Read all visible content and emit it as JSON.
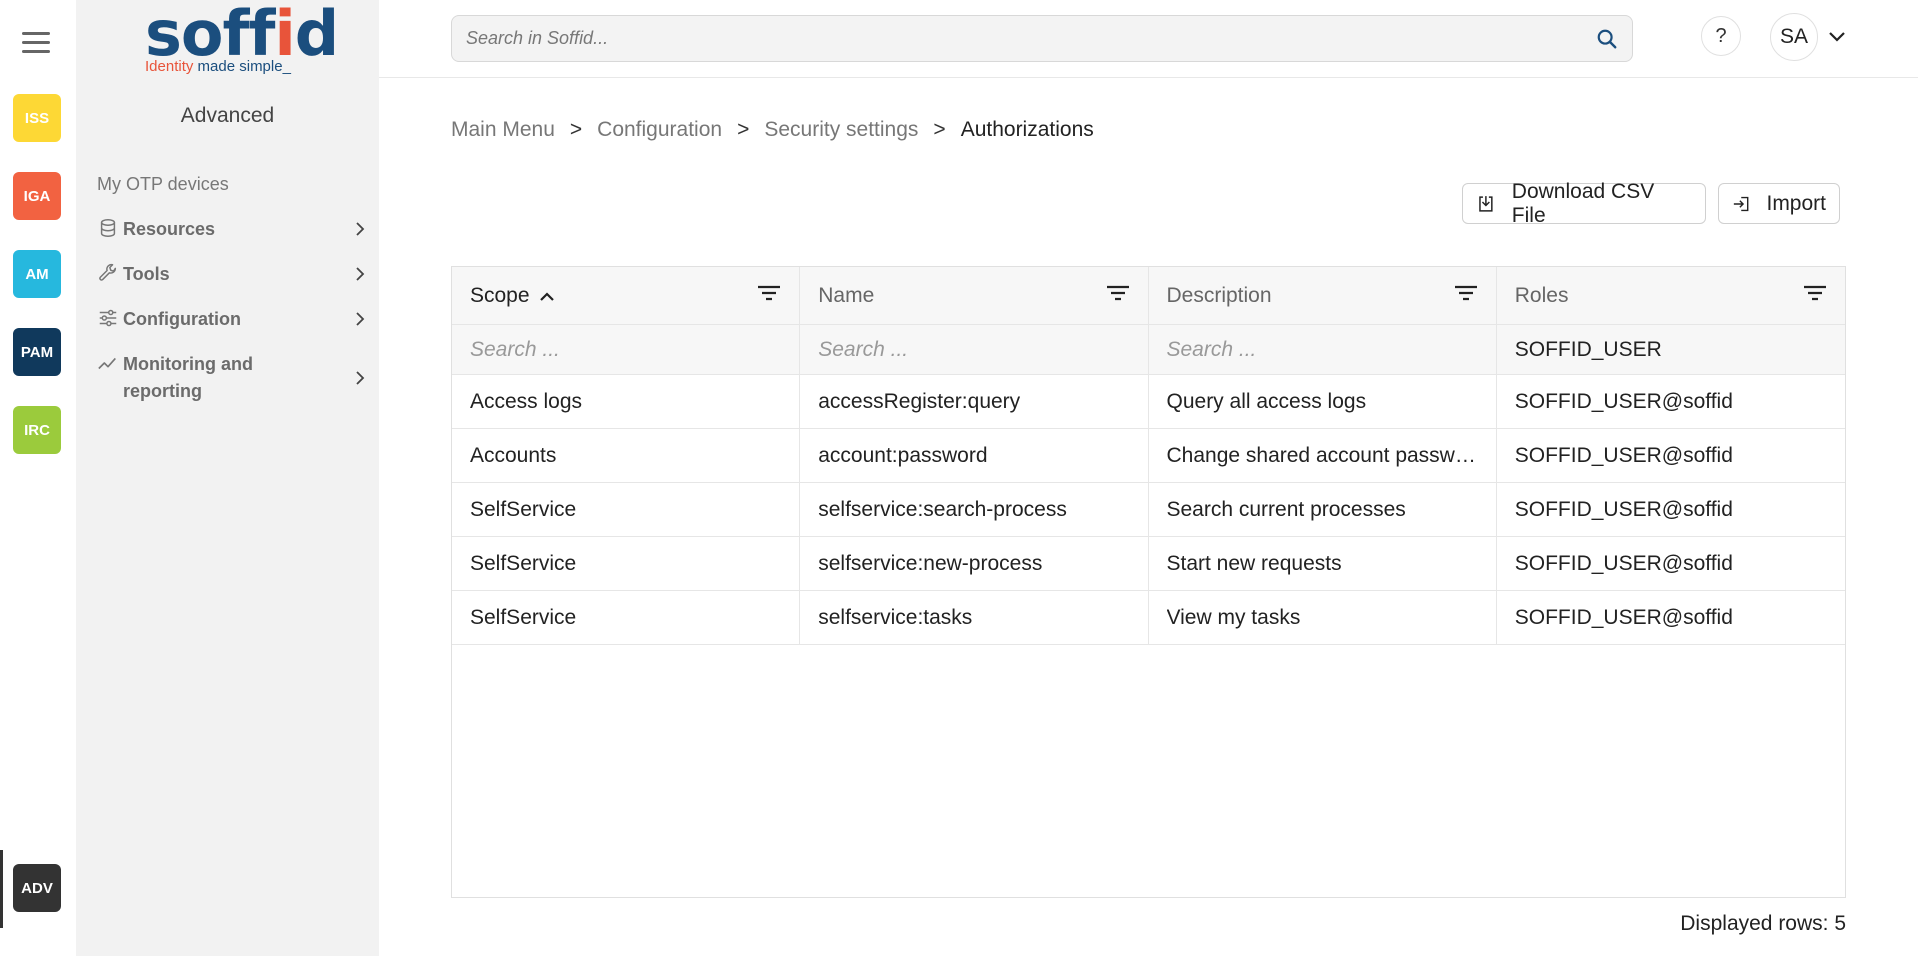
{
  "apps": [
    {
      "label": "ISS",
      "color": "#fdd835",
      "icon": "iss-app-icon"
    },
    {
      "label": "IGA",
      "color": "#f26241",
      "icon": "iga-app-icon"
    },
    {
      "label": "AM",
      "color": "#26b8de",
      "icon": "am-app-icon"
    },
    {
      "label": "PAM",
      "color": "#10395c",
      "icon": "pam-app-icon"
    },
    {
      "label": "IRC",
      "color": "#9bcb3c",
      "icon": "irc-app-icon"
    }
  ],
  "active_app": {
    "label": "ADV",
    "color": "#333333"
  },
  "logo": {
    "word_a": "soff",
    "word_b": "i",
    "word_c": "d",
    "tag_a": "Identity",
    "tag_b": " made simple_"
  },
  "sidebar": {
    "title": "Advanced",
    "link": "My OTP devices",
    "items": [
      {
        "label": "Resources",
        "icon": "database-icon"
      },
      {
        "label": "Tools",
        "icon": "wrench-icon"
      },
      {
        "label": "Configuration",
        "icon": "sliders-icon"
      },
      {
        "label": "Monitoring and reporting",
        "icon": "chart-line-icon"
      }
    ]
  },
  "topbar": {
    "search_placeholder": "Search in Soffid...",
    "help_label": "?",
    "user_initials": "SA"
  },
  "breadcrumb": {
    "items": [
      "Main Menu",
      "Configuration",
      "Security settings",
      "Authorizations"
    ],
    "separator": ">"
  },
  "actions": {
    "download_label": "Download CSV File",
    "import_label": "Import"
  },
  "table": {
    "columns": [
      {
        "label": "Scope",
        "sorted": "asc"
      },
      {
        "label": "Name"
      },
      {
        "label": "Description"
      },
      {
        "label": "Roles"
      }
    ],
    "filters": [
      {
        "placeholder": "Search ...",
        "value": ""
      },
      {
        "placeholder": "Search ...",
        "value": ""
      },
      {
        "placeholder": "Search ...",
        "value": ""
      },
      {
        "placeholder": "",
        "value": "SOFFID_USER"
      }
    ],
    "rows": [
      [
        "Access logs",
        "accessRegister:query",
        "Query all access logs",
        "SOFFID_USER@soffid"
      ],
      [
        "Accounts",
        "account:password",
        "Change shared account passwords",
        "SOFFID_USER@soffid"
      ],
      [
        "SelfService",
        "selfservice:search-process",
        "Search current processes",
        "SOFFID_USER@soffid"
      ],
      [
        "SelfService",
        "selfservice:new-process",
        "Start new requests",
        "SOFFID_USER@soffid"
      ],
      [
        "SelfService",
        "selfservice:tasks",
        "View my tasks",
        "SOFFID_USER@soffid"
      ]
    ]
  },
  "footer": {
    "displayed_rows_label": "Displayed rows: 5"
  }
}
